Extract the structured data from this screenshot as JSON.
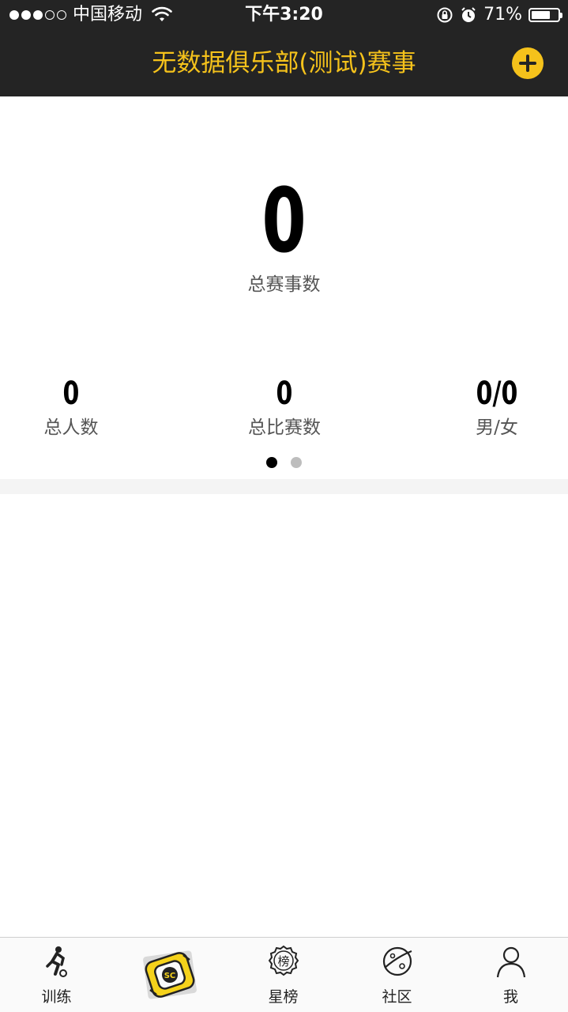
{
  "status_bar": {
    "carrier": "中国移动",
    "time": "下午3:20",
    "battery_percent": "71%",
    "battery_level": 0.71
  },
  "nav": {
    "title": "无数据俱乐部(测试)赛事"
  },
  "stats": {
    "total_events": {
      "value": "0",
      "label": "总赛事数"
    },
    "total_people": {
      "value": "0",
      "label": "总人数"
    },
    "total_matches": {
      "value": "0",
      "label": "总比赛数"
    },
    "gender_ratio": {
      "value": "0/0",
      "label": "男/女"
    }
  },
  "pager": {
    "pages": 2,
    "current": 1
  },
  "tabbar": {
    "items": [
      {
        "label": "训练",
        "icon": "soccer-player-icon"
      },
      {
        "label": "",
        "icon": "club-logo-icon"
      },
      {
        "label": "星榜",
        "icon": "ranking-badge-icon"
      },
      {
        "label": "社区",
        "icon": "planet-icon"
      },
      {
        "label": "我",
        "icon": "user-icon"
      }
    ]
  },
  "colors": {
    "header_bg": "#242424",
    "accent": "#f5c21b",
    "text_dark": "#000000",
    "text_muted": "#555555"
  }
}
